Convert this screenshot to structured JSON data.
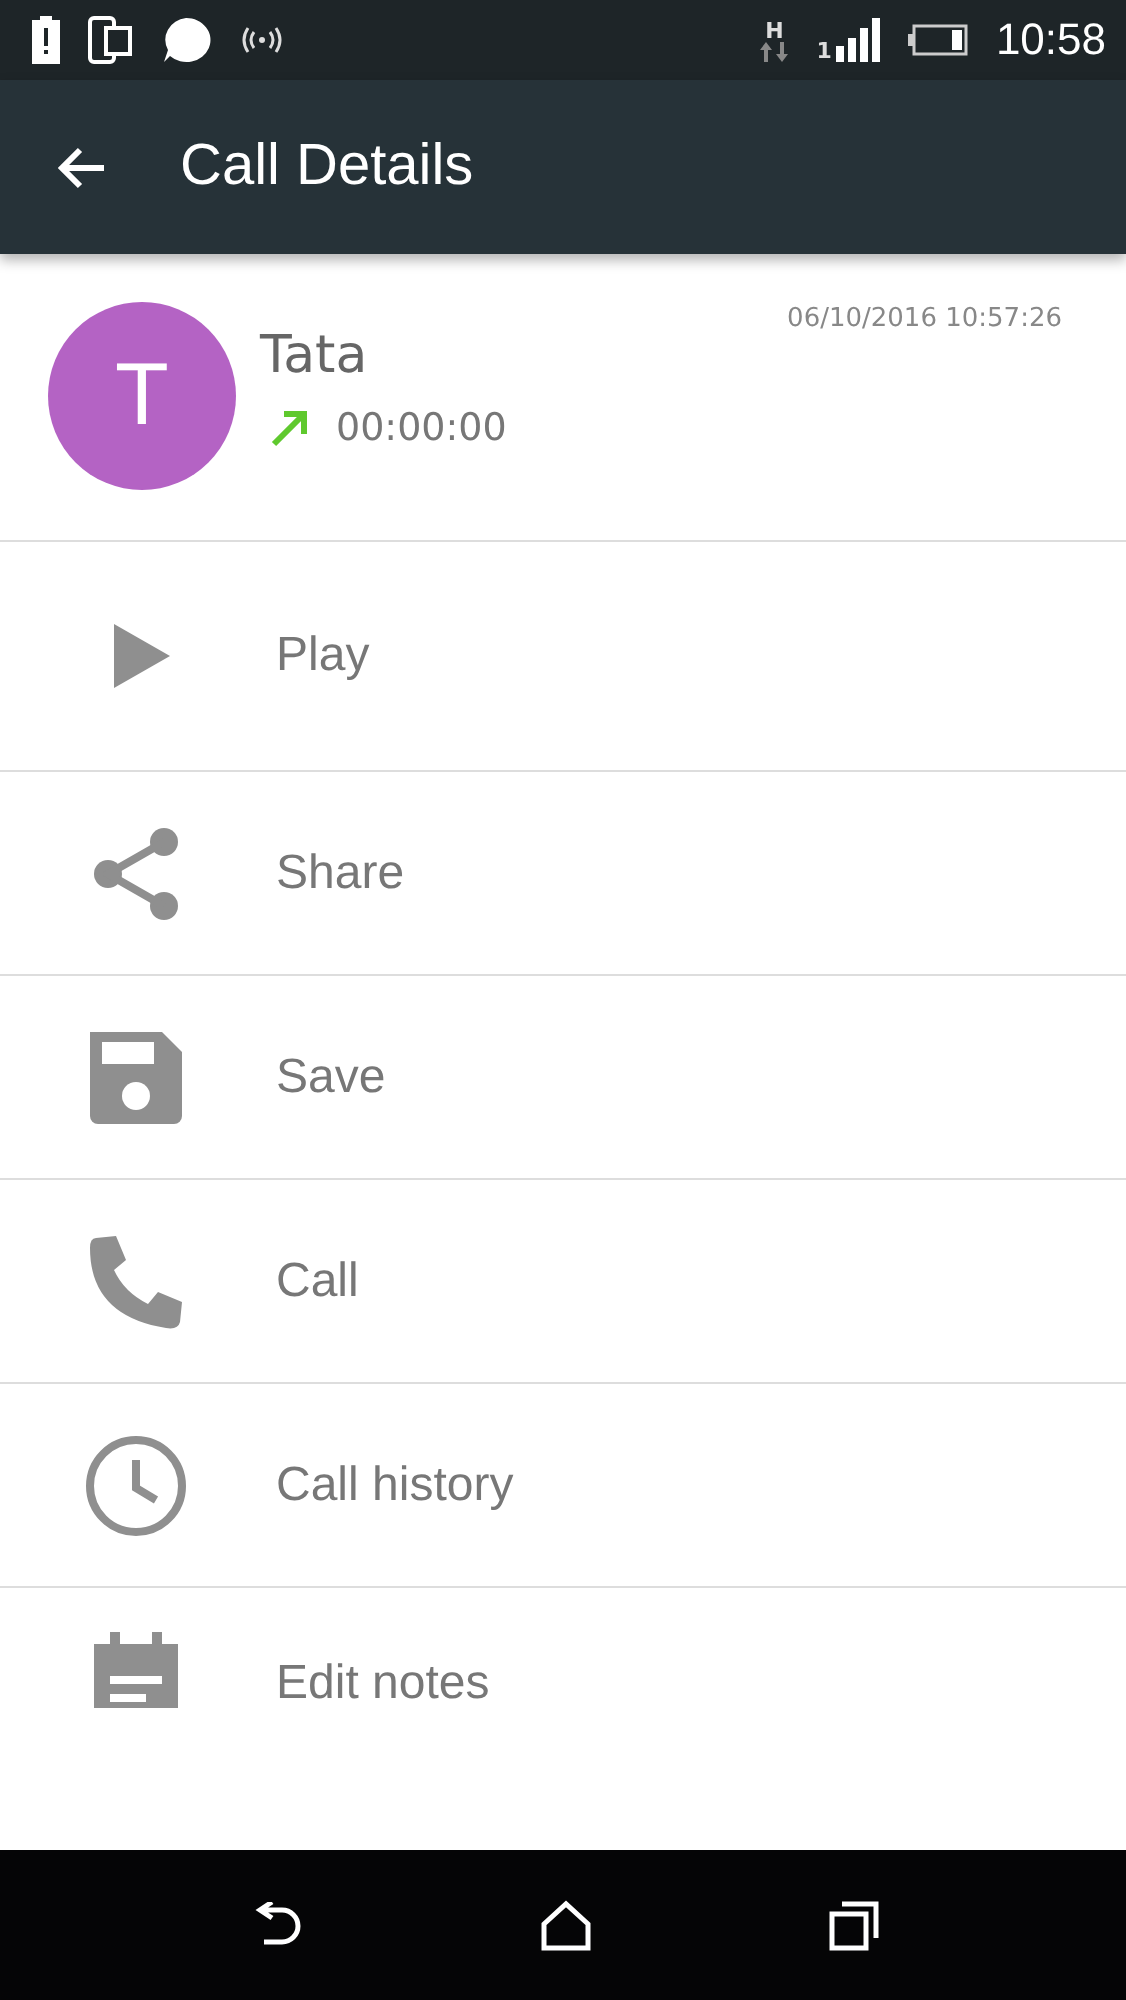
{
  "status_bar": {
    "network": "H",
    "sim": "1",
    "time": "10:58"
  },
  "toolbar": {
    "title": "Call Details"
  },
  "contact": {
    "initial": "T",
    "name": "Tata",
    "outgoing": true,
    "duration": "00:00:00",
    "timestamp": "06/10/2016 10:57:26"
  },
  "actions": [
    {
      "kind": "play",
      "label": "Play"
    },
    {
      "kind": "share",
      "label": "Share"
    },
    {
      "kind": "save",
      "label": "Save"
    },
    {
      "kind": "call",
      "label": "Call"
    },
    {
      "kind": "history",
      "label": "Call history"
    },
    {
      "kind": "notes",
      "label": "Edit notes"
    }
  ]
}
